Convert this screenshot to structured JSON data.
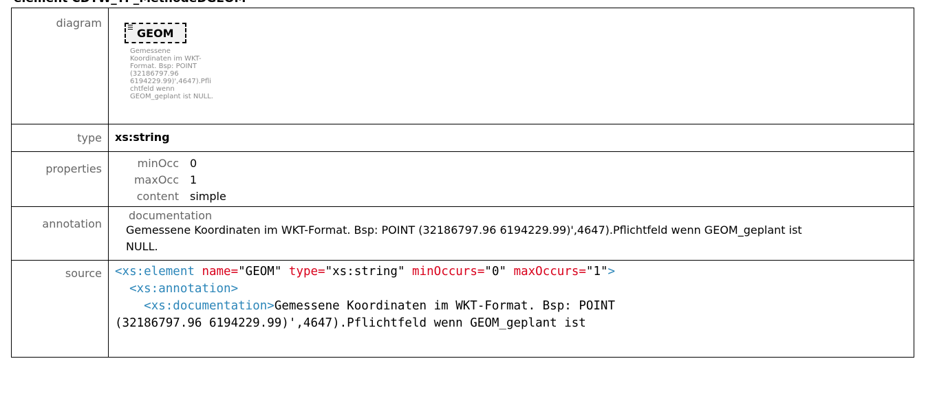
{
  "heading": "element CDTW_TP_MethodeDGEOM",
  "labels": {
    "diagram": "diagram",
    "type": "type",
    "properties": "properties",
    "annotation": "annotation",
    "source": "source"
  },
  "diagram": {
    "element_name": "GEOM",
    "description": "Gemessene Koordinaten im WKT-Format. Bsp: POINT (32186797.96 6194229.99)',4647).Pflichtfeld wenn GEOM_geplant ist NULL."
  },
  "type_value": "xs:string",
  "properties": [
    {
      "key": "minOcc",
      "value": "0"
    },
    {
      "key": "maxOcc",
      "value": "1"
    },
    {
      "key": "content",
      "value": "simple"
    }
  ],
  "annotation": {
    "label": "documentation",
    "text": "Gemessene Koordinaten im WKT-Format. Bsp: POINT (32186797.96 6194229.99)',4647).Pflichtfeld wenn GEOM_geplant ist NULL."
  },
  "source": {
    "l1_tag": "<xs:element",
    "l1_attr1": "name=",
    "l1_val1": "\"GEOM\"",
    "l1_attr2": "type=",
    "l1_val2": "\"xs:string\"",
    "l1_attr3": "minOccurs=",
    "l1_val3": "\"0\"",
    "l1_attr4": "maxOccurs=",
    "l1_val4": "\"1\"",
    "l1_close": ">",
    "l2_tag": "<xs:annotation>",
    "l3_tag": "<xs:documentation>",
    "l3_text": "Gemessene Koordinaten im WKT-Format. Bsp: POINT",
    "l4_text": "(32186797.96 6194229.99)',4647).Pflichtfeld wenn GEOM_geplant ist"
  }
}
